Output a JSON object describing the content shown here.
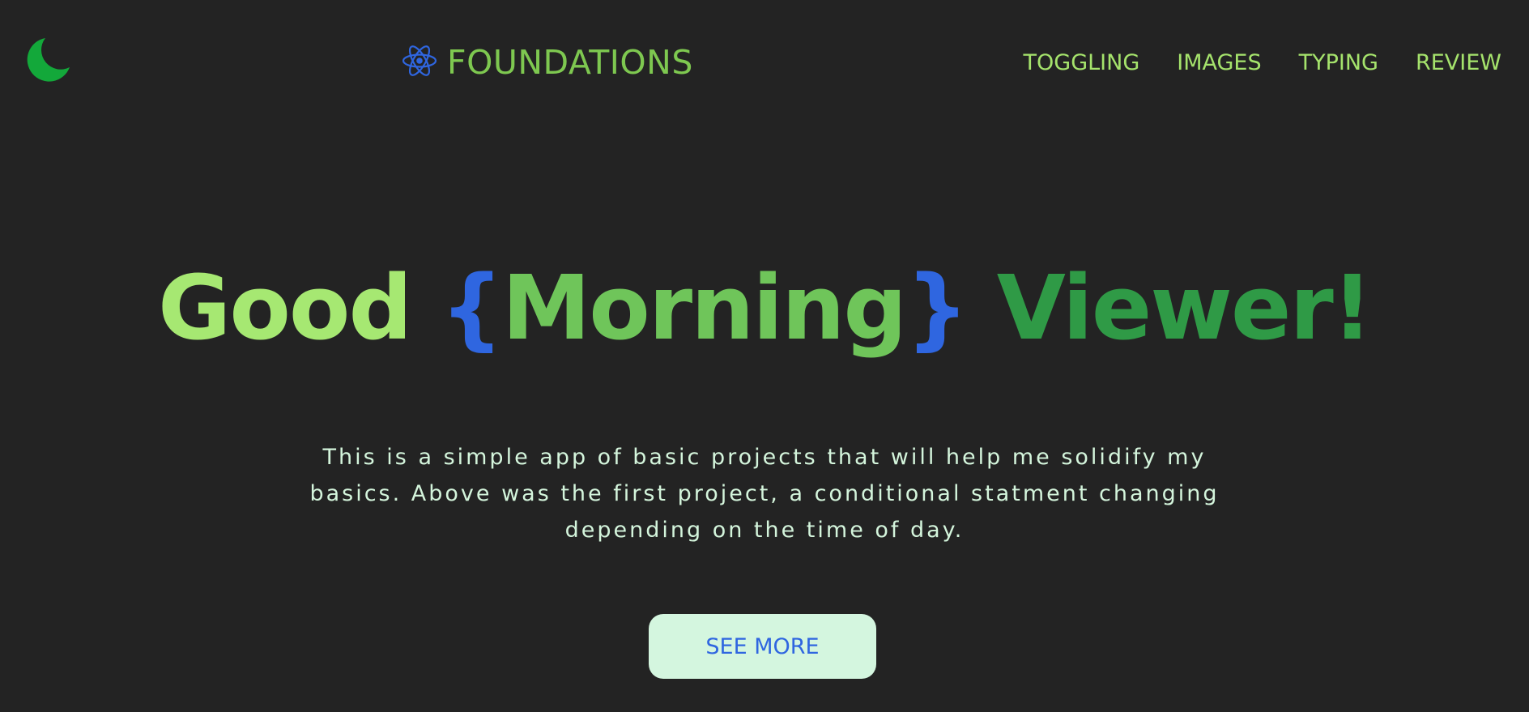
{
  "header": {
    "theme_icon": "moon-icon",
    "brand": {
      "icon": "react-atom-icon",
      "title": "FOUNDATIONS"
    },
    "nav": [
      "TOGGLING",
      "IMAGES",
      "TYPING",
      "REVIEW"
    ]
  },
  "hero": {
    "greeting_word": "Good",
    "open_brace": "{",
    "time_word": "Morning",
    "close_brace": "}",
    "audience_word": "Viewer!",
    "description": "This is a simple app of basic projects that will help me solidify my basics. Above was the first project, a conditional statment changing depending on the time of day.",
    "cta_label": "SEE MORE"
  },
  "colors": {
    "background": "#232323",
    "brand_green": "#7ec850",
    "nav_green": "#a5e36c",
    "accent_blue": "#2f66e0",
    "moon_green": "#13a83a",
    "cta_background": "#d4f6df"
  }
}
